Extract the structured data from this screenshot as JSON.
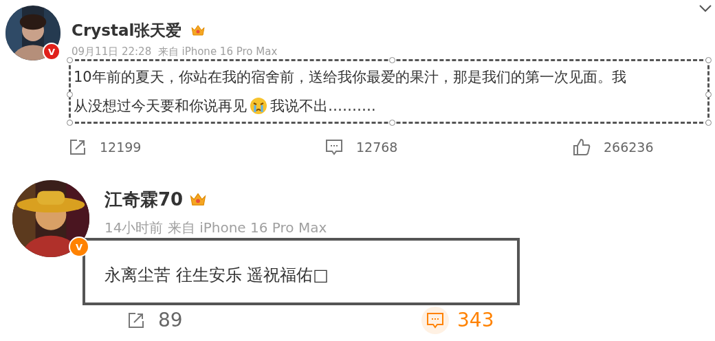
{
  "posts": [
    {
      "author": "Crystal张天爱",
      "verified_badge": "V",
      "meta": "09月11日 22:28  来自 iPhone 16 Pro Max",
      "text_lines": [
        [
          {
            "kind": "text",
            "text": "10年前的夏天，你站在我的宿舍前，送给我你最爱的果汁，那是我们的第一次见面。我"
          }
        ],
        [
          {
            "kind": "text",
            "text": "从没想过今天要和你说再见"
          },
          {
            "kind": "emoji"
          },
          {
            "kind": "text",
            "text": "我说不出………."
          }
        ]
      ],
      "frame": {
        "kind": "selection"
      },
      "actions": [
        {
          "kind": "share",
          "count": "12199",
          "selected": false
        },
        {
          "kind": "comment",
          "count": "12768",
          "selected": false
        },
        {
          "kind": "like",
          "count": "266236",
          "selected": false
        }
      ]
    },
    {
      "author": "江奇霖70",
      "verified_badge": "V",
      "meta": "14小时前 来自 iPhone 16 Pro Max",
      "text_lines": [
        [
          {
            "kind": "text",
            "text": "永离尘苦 往生安乐 遥祝福佑□"
          }
        ]
      ],
      "frame": {
        "kind": "box"
      },
      "actions": [
        {
          "kind": "share",
          "count": "89",
          "selected": false
        },
        {
          "kind": "comment",
          "count": "343",
          "selected": true
        }
      ]
    }
  ]
}
